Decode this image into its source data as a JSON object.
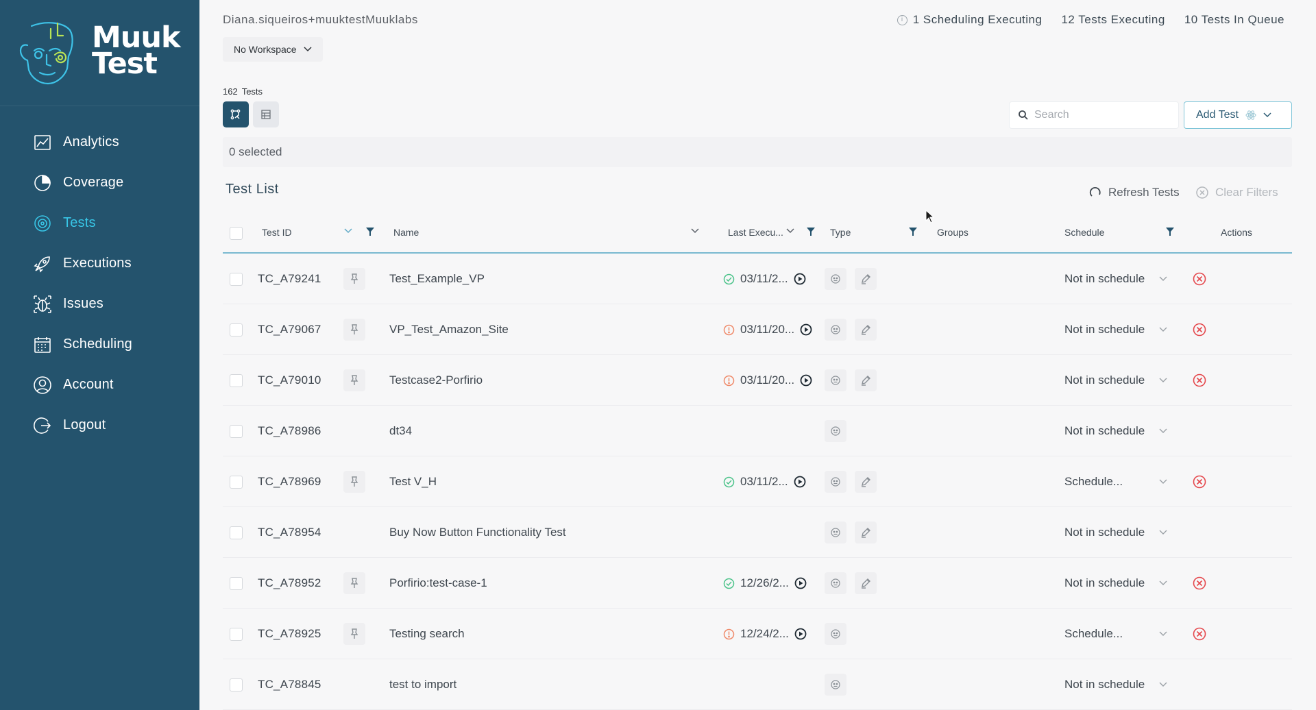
{
  "sidebar": {
    "logo_line1": "Muuk",
    "logo_line2": "Test",
    "items": [
      {
        "label": "Analytics",
        "icon": "analytics-icon"
      },
      {
        "label": "Coverage",
        "icon": "coverage-icon"
      },
      {
        "label": "Tests",
        "icon": "tests-icon",
        "active": true
      },
      {
        "label": "Executions",
        "icon": "rocket-icon"
      },
      {
        "label": "Issues",
        "icon": "bug-icon"
      },
      {
        "label": "Scheduling",
        "icon": "calendar-icon"
      },
      {
        "label": "Account",
        "icon": "user-icon"
      },
      {
        "label": "Logout",
        "icon": "logout-icon"
      }
    ]
  },
  "header": {
    "user_email": "Diana.siqueiros+muuktestMuuklabs",
    "scheduling_executing": "1 Scheduling Executing",
    "tests_executing": "12 Tests Executing",
    "tests_in_queue": "10 Tests In Queue",
    "workspace_label": "No Workspace"
  },
  "toolbar": {
    "tests_count": "162",
    "tests_label": "Tests",
    "search_placeholder": "Search",
    "add_test_label": "Add Test",
    "selected_text": "0 selected"
  },
  "list": {
    "title": "Test List",
    "refresh_label": "Refresh Tests",
    "clear_filters_label": "Clear Filters",
    "columns": {
      "test_id": "Test ID",
      "name": "Name",
      "last_execution": "Last Execu...",
      "type": "Type",
      "groups": "Groups",
      "schedule": "Schedule",
      "actions": "Actions"
    },
    "rows": [
      {
        "id": "TC_A79241",
        "pin": true,
        "name": "Test_Example_VP",
        "status": "success",
        "date": "03/11/2...",
        "edit": true,
        "schedule": "Not in schedule",
        "delete": true
      },
      {
        "id": "TC_A79067",
        "pin": true,
        "name": "VP_Test_Amazon_Site",
        "status": "error",
        "date": "03/11/20...",
        "edit": true,
        "schedule": "Not in schedule",
        "delete": true
      },
      {
        "id": "TC_A79010",
        "pin": true,
        "name": "Testcase2-Porfirio",
        "status": "error",
        "date": "03/11/20...",
        "edit": true,
        "schedule": "Not in schedule",
        "delete": true
      },
      {
        "id": "TC_A78986",
        "pin": false,
        "name": "dt34",
        "status": "",
        "date": "",
        "edit": false,
        "schedule": "Not in schedule",
        "delete": false
      },
      {
        "id": "TC_A78969",
        "pin": true,
        "name": "Test V_H",
        "status": "success",
        "date": "03/11/2...",
        "edit": true,
        "schedule": "Schedule...",
        "delete": true
      },
      {
        "id": "TC_A78954",
        "pin": false,
        "name": "Buy Now Button Functionality Test",
        "status": "",
        "date": "",
        "edit": true,
        "schedule": "Not in schedule",
        "delete": false
      },
      {
        "id": "TC_A78952",
        "pin": true,
        "name": "Porfirio:test-case-1",
        "status": "success",
        "date": "12/26/2...",
        "edit": true,
        "schedule": "Not in schedule",
        "delete": true
      },
      {
        "id": "TC_A78925",
        "pin": true,
        "name": "Testing search",
        "status": "error",
        "date": "12/24/2...",
        "edit": false,
        "schedule": "Schedule...",
        "delete": true
      },
      {
        "id": "TC_A78845",
        "pin": false,
        "name": "test to import",
        "status": "",
        "date": "",
        "edit": false,
        "schedule": "Not in schedule",
        "delete": false
      }
    ]
  },
  "colors": {
    "sidebar_bg": "#24536d",
    "accent": "#38c5e6",
    "success": "#4cc38a",
    "error": "#ef8a6a",
    "delete": "#e5484d"
  }
}
